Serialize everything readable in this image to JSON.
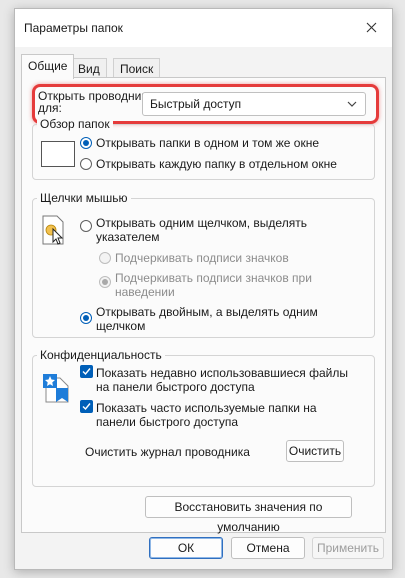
{
  "window": {
    "title": "Параметры папок"
  },
  "tabs": [
    {
      "label": "Общие"
    },
    {
      "label": "Вид"
    },
    {
      "label": "Поиск"
    }
  ],
  "general": {
    "open_explorer_label": "Открыть проводник для:",
    "open_explorer_value": "Быстрый доступ",
    "browse": {
      "title": "Обзор папок",
      "option_same_window": "Открывать папки в одном и том же окне",
      "option_new_window": "Открывать каждую папку в отдельном окне"
    },
    "click": {
      "title": "Щелчки мышью",
      "option_single": "Открывать одним щелчком, выделять указателем",
      "sub_always": "Подчеркивать подписи значков",
      "sub_hover": "Подчеркивать подписи значков при наведении",
      "option_double": "Открывать двойным, а выделять одним щелчком"
    },
    "privacy": {
      "title": "Конфиденциальность",
      "recent_files": "Показать недавно использовавшиеся файлы на панели быстрого доступа",
      "frequent_folders": "Показать часто используемые папки на панели быстрого доступа",
      "clear_label": "Очистить журнал проводника",
      "clear_button": "Очистить"
    },
    "restore_defaults": "Восстановить значения по умолчанию"
  },
  "footer": {
    "ok": "ОК",
    "cancel": "Отмена",
    "apply": "Применить"
  },
  "colors": {
    "accent": "#005fb8",
    "highlight": "#e53b3b"
  }
}
